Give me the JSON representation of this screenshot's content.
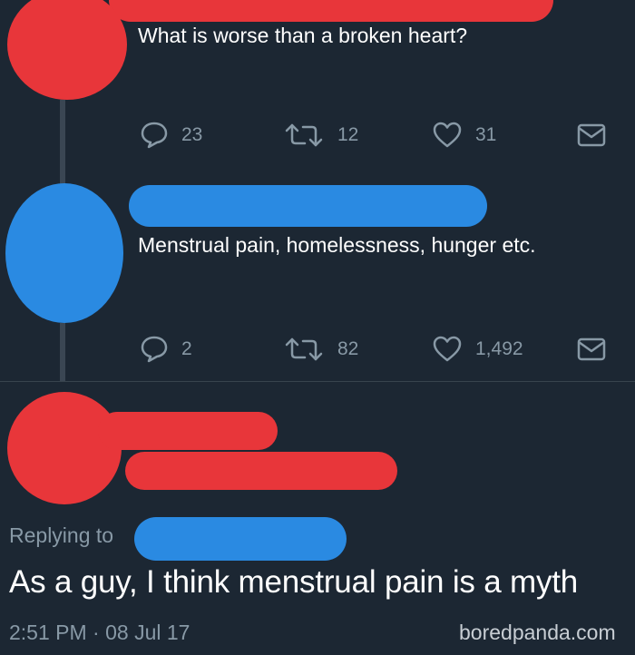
{
  "tweets": [
    {
      "text": "What is worse than a broken heart?",
      "actions": {
        "reply_count": "23",
        "retweet_count": "12",
        "like_count": "31"
      },
      "avatar_color": "#e8363a"
    },
    {
      "text": "Menstrual pain, homelessness, hunger etc.",
      "actions": {
        "reply_count": "2",
        "retweet_count": "82",
        "like_count": "1,492"
      },
      "avatar_color": "#2a8ae2"
    }
  ],
  "main_tweet": {
    "replying_to": "Replying to",
    "text": "As a guy, I think menstrual pain is a myth",
    "timestamp": "2:51 PM · 08 Jul 17"
  },
  "watermark": "boredpanda.com",
  "colors": {
    "background": "#1c2733",
    "redact_red": "#e8363a",
    "redact_blue": "#2a8ae2",
    "muted": "#8899a6"
  },
  "icons": [
    "reply-icon",
    "retweet-icon",
    "like-icon",
    "message-icon"
  ]
}
